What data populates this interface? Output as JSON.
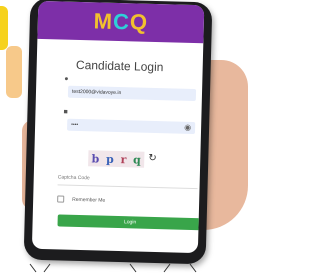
{
  "app": {
    "logo_letters": [
      "M",
      "C",
      "Q"
    ]
  },
  "login": {
    "title": "Candidate Login",
    "email_value": "test2000@vidavoye.in",
    "password_mask": "••••",
    "captcha_chars": [
      "b",
      "p",
      "r",
      "q"
    ],
    "captcha_placeholder": "Captcha Code",
    "remember_label": "Remember Me",
    "login_button": "Login"
  },
  "colors": {
    "header": "#7d2fa8",
    "login_button": "#39a54a",
    "field_bg": "#e8eefb"
  }
}
